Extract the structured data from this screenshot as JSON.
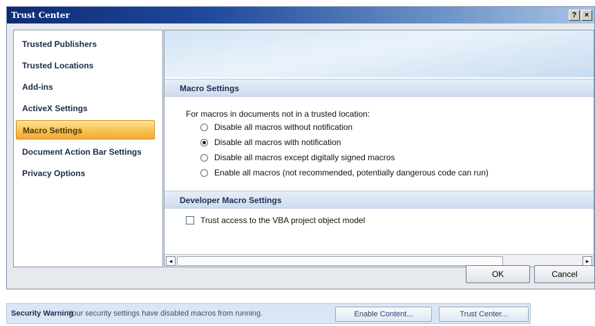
{
  "window": {
    "title": "Trust Center",
    "help_glyph": "?",
    "close_glyph": "×"
  },
  "sidebar": {
    "items": [
      {
        "label": "Trusted Publishers"
      },
      {
        "label": "Trusted Locations"
      },
      {
        "label": "Add-ins"
      },
      {
        "label": "ActiveX Settings"
      },
      {
        "label": "Macro Settings",
        "selected": true
      },
      {
        "label": "Document Action Bar Settings"
      },
      {
        "label": "Privacy Options"
      }
    ]
  },
  "macro_settings": {
    "header": "Macro Settings",
    "intro": "For macros in documents not in a trusted location:",
    "options": [
      {
        "label": "Disable all macros without notification",
        "checked": false
      },
      {
        "label": "Disable all macros with notification",
        "checked": true
      },
      {
        "label": "Disable all macros except digitally signed macros",
        "checked": false
      },
      {
        "label": "Enable all macros (not recommended, potentially dangerous code can run)",
        "checked": false
      }
    ]
  },
  "developer_settings": {
    "header": "Developer Macro Settings",
    "vba_access_label": "Trust access to the VBA project object model",
    "vba_access_checked": false
  },
  "scrollbar": {
    "left_arrow": "◂",
    "right_arrow": "▸"
  },
  "buttons": {
    "ok": "OK",
    "cancel": "Cancel"
  },
  "security_bar": {
    "title": "Security Warning",
    "message": "Your security settings have disabled macros from running.",
    "enable_content": "Enable Content...",
    "trust_center": "Trust Center..."
  },
  "colors": {
    "title_bar": "#1f4a9e",
    "selection": "#f7c24f",
    "security_bar": "#dbe6f4"
  }
}
